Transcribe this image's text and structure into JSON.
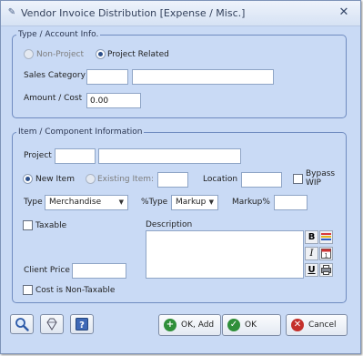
{
  "window": {
    "title": "Vendor Invoice Distribution [Expense / Misc.]",
    "close_glyph": "✕",
    "app_icon": "invoice-icon"
  },
  "account": {
    "group_title": "Type / Account Info.",
    "non_project": "Non-Project",
    "project_related": "Project Related",
    "sales_category_label": "Sales Category",
    "sales_category_code": "",
    "sales_category_desc": "",
    "amount_label": "Amount / Cost",
    "amount_value": "0.00"
  },
  "item": {
    "group_title": "Item / Component Information",
    "project_label": "Project",
    "project_code": "",
    "project_desc": "",
    "new_item": "New Item",
    "existing_item": "Existing Item:",
    "existing_item_value": "",
    "location_label": "Location",
    "location_value": "",
    "bypass_wip_line1": "Bypass",
    "bypass_wip_line2": "WIP",
    "type_label": "Type",
    "type_value": "Merchandise",
    "pct_type_label": "%Type",
    "pct_type_value": "Markup",
    "markup_label": "Markup%",
    "markup_value": "",
    "taxable_label": "Taxable",
    "description_label": "Description",
    "description_value": "",
    "client_price_label": "Client Price",
    "client_price_value": "",
    "cost_non_taxable_label": "Cost is Non-Taxable"
  },
  "format_buttons": {
    "bold": "B",
    "italic": "I",
    "underline": "U"
  },
  "buttons": {
    "ok_add": "OK, Add",
    "ok": "OK",
    "cancel": "Cancel"
  },
  "colors": {
    "dialog_bg": "#c9daf5",
    "group_border": "#6f8bc0",
    "ok_add_icon": "#2f8f3a",
    "ok_icon": "#2f8f3a",
    "cancel_icon": "#c4302b"
  }
}
